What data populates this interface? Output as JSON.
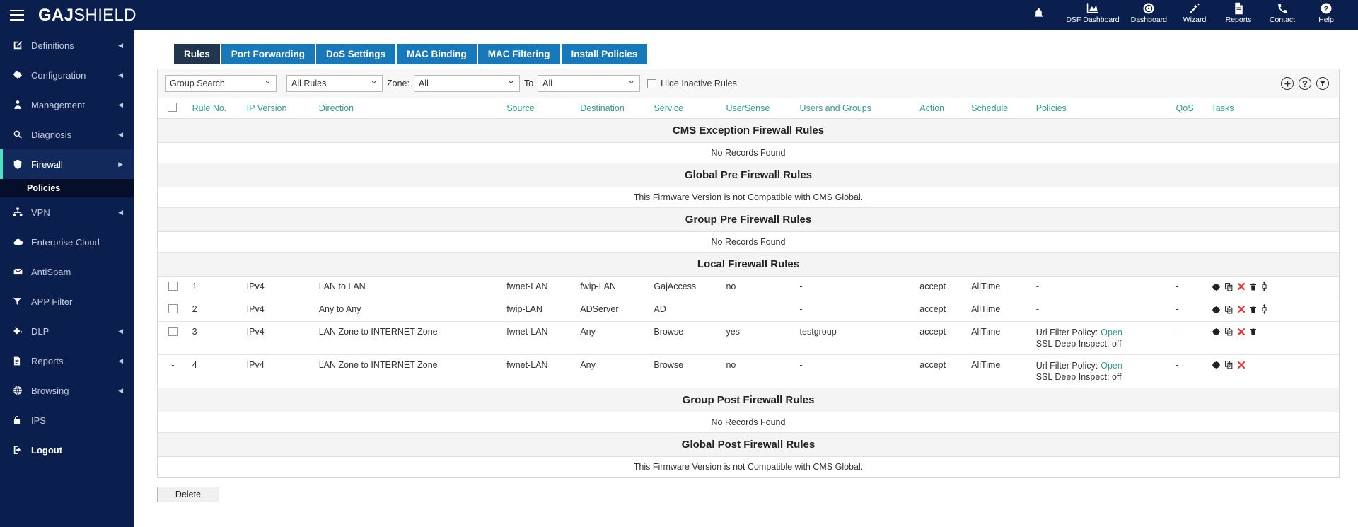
{
  "brand": {
    "bold": "GAJ",
    "light": "SHIELD"
  },
  "header": {
    "notification_icon": "bell-icon",
    "icons": [
      {
        "name": "dsf-dashboard-icon",
        "glyph": "Ὄ8",
        "label": "DSF Dashboard"
      },
      {
        "name": "dashboard-icon",
        "glyph": "⏱",
        "label": "Dashboard"
      },
      {
        "name": "wizard-icon",
        "glyph": "✨",
        "label": "Wizard"
      },
      {
        "name": "reports-icon",
        "glyph": "Ὄ4",
        "label": "Reports"
      },
      {
        "name": "contact-icon",
        "glyph": "✆",
        "label": "Contact"
      },
      {
        "name": "help-icon",
        "glyph": "?",
        "label": "Help"
      }
    ]
  },
  "sidebar": {
    "items": [
      {
        "label": "Definitions",
        "icon": "edit-square-icon",
        "arrow": "left",
        "active": false,
        "sub": null
      },
      {
        "label": "Configuration",
        "icon": "gear-icon",
        "arrow": "left",
        "active": false,
        "sub": null
      },
      {
        "label": "Management",
        "icon": "user-tie-icon",
        "arrow": "left",
        "active": false,
        "sub": null
      },
      {
        "label": "Diagnosis",
        "icon": "magnifier-icon",
        "arrow": "left",
        "active": false,
        "sub": null
      },
      {
        "label": "Firewall",
        "icon": "shield-icon",
        "arrow": "right",
        "active": true,
        "sub": "Policies"
      },
      {
        "label": "VPN",
        "icon": "network-icon",
        "arrow": "left",
        "active": false,
        "sub": null
      },
      {
        "label": "Enterprise Cloud",
        "icon": "cloud-icon",
        "arrow": "none",
        "active": false,
        "sub": null
      },
      {
        "label": "AntiSpam",
        "icon": "envelope-icon",
        "arrow": "none",
        "active": false,
        "sub": null
      },
      {
        "label": "APP Filter",
        "icon": "funnel-icon",
        "arrow": "none",
        "active": false,
        "sub": null
      },
      {
        "label": "DLP",
        "icon": "paint-bucket-icon",
        "arrow": "left",
        "active": false,
        "sub": null
      },
      {
        "label": "Reports",
        "icon": "document-icon",
        "arrow": "left",
        "active": false,
        "sub": null
      },
      {
        "label": "Browsing",
        "icon": "globe-icon",
        "arrow": "left",
        "active": false,
        "sub": null
      },
      {
        "label": "IPS",
        "icon": "lock-icon",
        "arrow": "none",
        "active": false,
        "sub": null
      },
      {
        "label": "Logout",
        "icon": "logout-icon",
        "arrow": "none",
        "active": false,
        "sub": null
      }
    ]
  },
  "tabs": [
    {
      "label": "Rules",
      "active": true
    },
    {
      "label": "Port Forwarding",
      "active": false
    },
    {
      "label": "DoS Settings",
      "active": false
    },
    {
      "label": "MAC Binding",
      "active": false
    },
    {
      "label": "MAC Filtering",
      "active": false
    },
    {
      "label": "Install Policies",
      "active": false
    }
  ],
  "filter": {
    "group_search": "Group Search",
    "rules_filter": "All Rules",
    "zone_label": "Zone:",
    "zone_from": "All",
    "to_label": "To",
    "zone_to": "All",
    "hide_inactive_label": "Hide Inactive Rules",
    "hide_inactive_checked": false,
    "tools": [
      {
        "name": "add-rule-icon",
        "glyph": "+"
      },
      {
        "name": "help-circle-icon",
        "glyph": "?"
      },
      {
        "name": "filter-icon",
        "glyph": "▼"
      }
    ]
  },
  "table": {
    "columns": [
      "",
      "Rule No.",
      "IP Version",
      "Direction",
      "Source",
      "Destination",
      "Service",
      "UserSense",
      "Users and Groups",
      "Action",
      "Schedule",
      "Policies",
      "QoS",
      "Tasks"
    ],
    "sections": [
      {
        "title": "CMS Exception Firewall Rules",
        "message": "No Records Found",
        "rows": []
      },
      {
        "title": "Global Pre Firewall Rules",
        "message": "This Firmware Version is not Compatible with CMS Global.",
        "rows": []
      },
      {
        "title": "Group Pre Firewall Rules",
        "message": "No Records Found",
        "rows": []
      },
      {
        "title": "Local Firewall Rules",
        "message": null,
        "rows": [
          {
            "checkbox": true,
            "select_dash": "",
            "rule_no": "1",
            "rule_no_link": true,
            "ip_version": "IPv4",
            "direction": "LAN to LAN",
            "source": "fwnet-LAN",
            "destination": "fwip-LAN",
            "service": "GajAccess",
            "usersense": "no",
            "users_groups": "-",
            "users_groups_link": false,
            "action": "accept",
            "schedule": "AllTime",
            "policy_url_label": "",
            "policy_url_value": "",
            "policy_ssl": "",
            "policy_dash": "-",
            "qos": "-",
            "tasks": [
              "gear-icon",
              "copy-icon",
              "disable-icon",
              "delete-icon",
              "move-icon"
            ]
          },
          {
            "checkbox": true,
            "select_dash": "",
            "rule_no": "2",
            "rule_no_link": false,
            "ip_version": "IPv4",
            "direction": "Any to Any",
            "source": "fwip-LAN",
            "destination": "ADServer",
            "service": "AD",
            "usersense": "",
            "users_groups": "-",
            "users_groups_link": false,
            "action": "accept",
            "schedule": "AllTime",
            "policy_url_label": "",
            "policy_url_value": "",
            "policy_ssl": "",
            "policy_dash": "-",
            "qos": "-",
            "tasks": [
              "gear-icon",
              "copy-icon",
              "disable-icon",
              "delete-icon",
              "move-icon"
            ]
          },
          {
            "checkbox": true,
            "select_dash": "",
            "rule_no": "3",
            "rule_no_link": true,
            "ip_version": "IPv4",
            "direction": "LAN Zone to INTERNET Zone",
            "source": "fwnet-LAN",
            "destination": "Any",
            "service": "Browse",
            "usersense": "yes",
            "users_groups": "testgroup",
            "users_groups_link": true,
            "action": "accept",
            "schedule": "AllTime",
            "policy_url_label": "Url Filter Policy:",
            "policy_url_value": "Open",
            "policy_ssl": "SSL Deep Inspect: off",
            "policy_dash": "",
            "qos": "-",
            "tasks": [
              "gear-icon",
              "copy-icon",
              "disable-icon",
              "delete-icon"
            ]
          },
          {
            "checkbox": false,
            "select_dash": "-",
            "rule_no": "4",
            "rule_no_link": true,
            "ip_version": "IPv4",
            "direction": "LAN Zone to INTERNET Zone",
            "source": "fwnet-LAN",
            "destination": "Any",
            "service": "Browse",
            "usersense": "no",
            "users_groups": "-",
            "users_groups_link": false,
            "action": "accept",
            "schedule": "AllTime",
            "policy_url_label": "Url Filter Policy:",
            "policy_url_value": "Open",
            "policy_ssl": "SSL Deep Inspect: off",
            "policy_dash": "",
            "qos": "-",
            "tasks": [
              "gear-icon",
              "copy-icon",
              "disable-icon"
            ]
          }
        ]
      },
      {
        "title": "Group Post Firewall Rules",
        "message": "No Records Found",
        "rows": []
      },
      {
        "title": "Global Post Firewall Rules",
        "message": "This Firmware Version is not Compatible with CMS Global.",
        "rows": []
      }
    ]
  },
  "footer": {
    "delete_label": "Delete"
  },
  "colors": {
    "navy": "#0b1f4e",
    "tab_blue": "#1779ba",
    "tab_active": "#21354f",
    "teal": "#2e9e8f",
    "accent_green": "#4ee0c1",
    "accept_green": "#3c8c3c",
    "danger_red": "#e8312b"
  }
}
